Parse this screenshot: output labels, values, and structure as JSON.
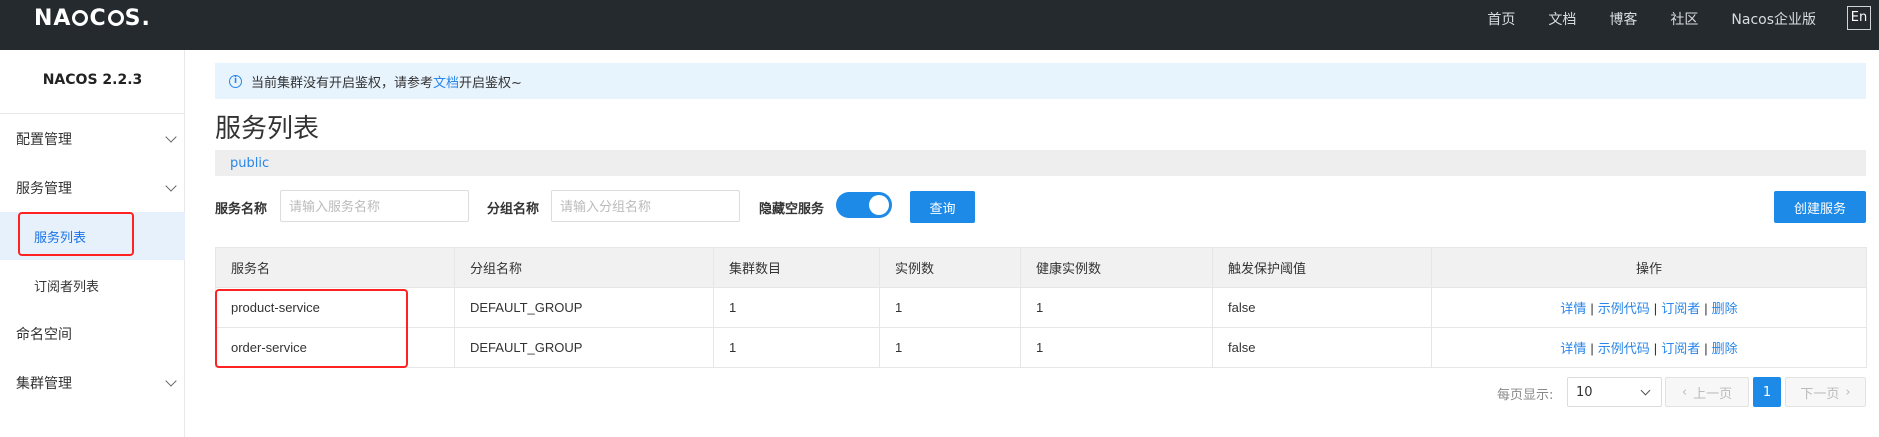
{
  "header": {
    "logo_text": "NACOS.",
    "nav": [
      "首页",
      "文档",
      "博客",
      "社区",
      "Nacos企业版"
    ],
    "lang_button": "En"
  },
  "sidebar": {
    "version": "NACOS 2.2.3",
    "items": [
      {
        "label": "配置管理",
        "expandable": true
      },
      {
        "label": "服务管理",
        "expandable": true
      },
      {
        "label": "服务列表",
        "sub": true,
        "active": true
      },
      {
        "label": "订阅者列表",
        "sub": true
      },
      {
        "label": "命名空间",
        "expandable": false
      },
      {
        "label": "集群管理",
        "expandable": true
      }
    ]
  },
  "notice": {
    "icon": "info-icon",
    "text_before": "当前集群没有开启鉴权，请参考",
    "link_text": "文档",
    "text_after": "开启鉴权~"
  },
  "page_title": "服务列表",
  "namespace": "public",
  "filters": {
    "service_name_label": "服务名称",
    "service_name_placeholder": "请输入服务名称",
    "group_name_label": "分组名称",
    "group_name_placeholder": "请输入分组名称",
    "hide_empty_label": "隐藏空服务",
    "hide_empty_enabled": true,
    "query_button": "查询",
    "create_button": "创建服务"
  },
  "table": {
    "columns": [
      "服务名",
      "分组名称",
      "集群数目",
      "实例数",
      "健康实例数",
      "触发保护阈值",
      "操作"
    ],
    "rows": [
      {
        "service": "product-service",
        "group": "DEFAULT_GROUP",
        "clusters": "1",
        "instances": "1",
        "healthy": "1",
        "threshold": "false"
      },
      {
        "service": "order-service",
        "group": "DEFAULT_GROUP",
        "clusters": "1",
        "instances": "1",
        "healthy": "1",
        "threshold": "false"
      }
    ],
    "actions": [
      "详情",
      "示例代码",
      "订阅者",
      "删除"
    ]
  },
  "pagination": {
    "page_size_label": "每页显示:",
    "page_size": "10",
    "prev": "上一页",
    "current_page": "1",
    "next": "下一页"
  },
  "colors": {
    "topbar": "#252a2f",
    "accent": "#1c8ae6",
    "highlight_box": "#ff2222"
  }
}
